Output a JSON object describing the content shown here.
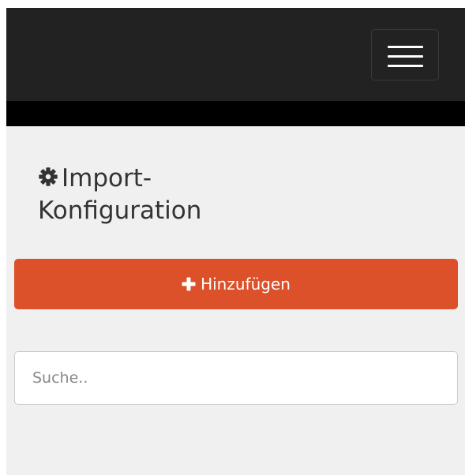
{
  "navbar": {
    "toggle_icon": "hamburger-menu-icon"
  },
  "page": {
    "title_icon": "gear-icon",
    "title": "Import-Konfiguration"
  },
  "actions": {
    "add_icon": "plus-icon",
    "add_label": "Hinzufügen"
  },
  "search": {
    "value": "",
    "placeholder": "Suche.."
  },
  "colors": {
    "navbar_background": "#222222",
    "navbar_band": "#000000",
    "page_background": "#f0f0f0",
    "accent_button": "#dc502a",
    "title_text": "#333333"
  }
}
